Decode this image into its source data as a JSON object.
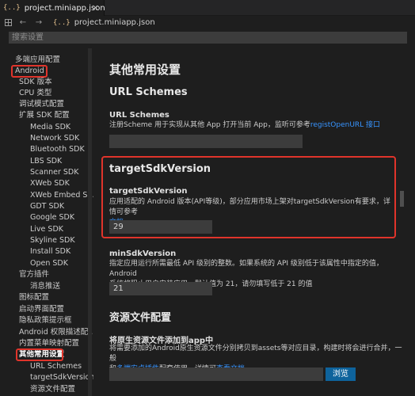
{
  "tab": {
    "icon": "{..}",
    "label": "project.miniapp.json",
    "close": "×"
  },
  "toolbar": {
    "back": "←",
    "forward": "→",
    "crumb_icon": "{..}",
    "crumb": "project.miniapp.json"
  },
  "search": {
    "placeholder": "搜索设置"
  },
  "sidebar": {
    "items": [
      "多端应用配置",
      "Android",
      "SDK 版本",
      "CPU 类型",
      "调试模式配置",
      "扩展 SDK 配置",
      "Media SDK",
      "Network SDK",
      "Bluetooth SDK",
      "LBS SDK",
      "Scanner SDK",
      "XWeb SDK",
      "XWeb Embed S...",
      "GDT SDK",
      "Google SDK",
      "Live SDK",
      "Skyline SDK",
      "Install SDK",
      "Open SDK",
      "官方插件",
      "消息推送",
      "图标配置",
      "启动界面配置",
      "隐私政策提示框",
      "Android 权限描述配...",
      "内置菜单映射配置",
      "其他常用设置",
      "URL Schemes",
      "targetSdkVersion",
      "资源文件配置"
    ]
  },
  "main": {
    "title": "其他常用设置",
    "url_section": {
      "heading": "URL Schemes",
      "label": "URL Schemes",
      "desc": "注册Scheme 用于实现从其他 App 打开当前 App，监听可参考",
      "link": "registOpenURL 接口",
      "value": ""
    },
    "target_section": {
      "heading": "targetSdkVersion",
      "label": "targetSdkVersion",
      "desc_line1": "应用适配的 Android 版本(API等级)，部分应用市场上架对targetSdkVersion有要求，详情可参考",
      "link": "文档",
      "value": "29"
    },
    "min_section": {
      "label": "minSdkVersion",
      "desc_line1": "指定应用运行所需最低 API 级别的整数。如果系统的 API 级别低于该属性中指定的值，Android",
      "desc_line2": "系统将阻止用户安装应用。默认值为 21，请勿填写低于 21 的值",
      "value": "21"
    },
    "res_section": {
      "heading": "资源文件配置",
      "label": "将原生资源文件添加到app中",
      "desc_line1": "将需要添加的Android原生资源文件分别拷贝到assets等对应目录，构建时将会进行合并，一般",
      "desc_pre": "和",
      "link1": "多端安卓插件",
      "desc_mid": "配套使用，详情可",
      "link2": "查看文档",
      "button": "浏览"
    }
  },
  "colors": {
    "highlight": "#e0342b",
    "link": "#3794ff",
    "button": "#0e639c"
  }
}
